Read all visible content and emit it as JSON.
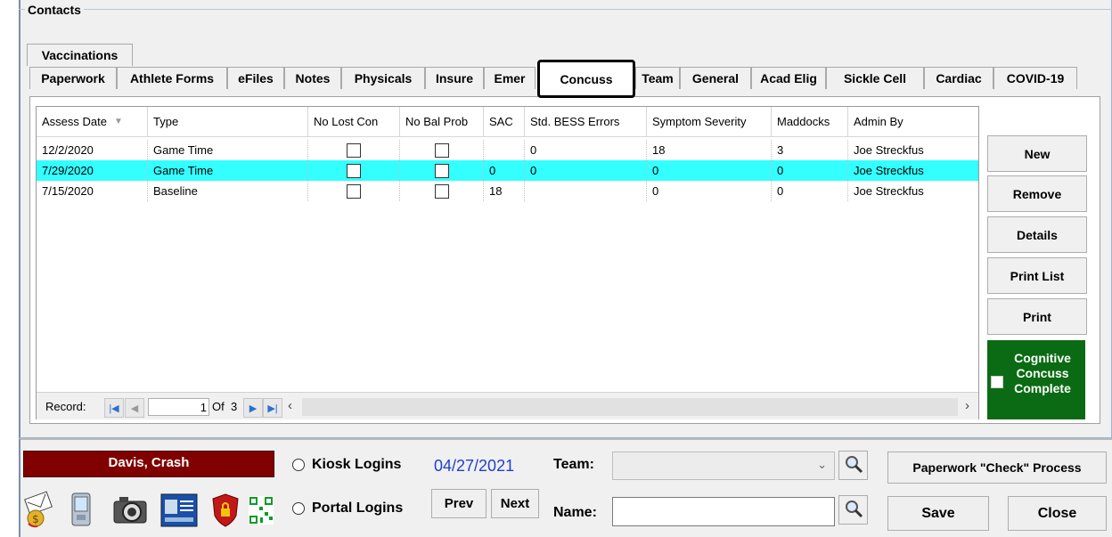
{
  "group_title": "Contacts",
  "tabs_row1": [
    {
      "label": "Vaccinations"
    }
  ],
  "tabs_row2": [
    {
      "label": "Paperwork"
    },
    {
      "label": "Athlete Forms"
    },
    {
      "label": "eFiles"
    },
    {
      "label": "Notes"
    },
    {
      "label": "Physicals"
    },
    {
      "label": "Insure"
    },
    {
      "label": "Emer"
    },
    {
      "label": "Concuss"
    },
    {
      "label": "Team"
    },
    {
      "label": "General"
    },
    {
      "label": "Acad Elig"
    },
    {
      "label": "Sickle Cell"
    },
    {
      "label": "Cardiac"
    },
    {
      "label": "COVID-19"
    }
  ],
  "active_tab": "Concuss",
  "grid": {
    "columns": [
      "Assess Date",
      "Type",
      "No Lost Con",
      "No Bal Prob",
      "SAC",
      "Std. BESS Errors",
      "Symptom Severity",
      "Maddocks",
      "Admin By"
    ],
    "rows": [
      {
        "date": "12/2/2020",
        "type": "Game Time",
        "no_lost_con": false,
        "no_bal_prob": false,
        "sac": "",
        "bess": "0",
        "severity": "18",
        "maddocks": "3",
        "admin": "Joe Streckfus",
        "selected": false
      },
      {
        "date": "7/29/2020",
        "type": "Game Time",
        "no_lost_con": false,
        "no_bal_prob": false,
        "sac": "0",
        "bess": "0",
        "severity": "0",
        "maddocks": "0",
        "admin": "Joe Streckfus",
        "selected": true
      },
      {
        "date": "7/15/2020",
        "type": "Baseline",
        "no_lost_con": false,
        "no_bal_prob": false,
        "sac": "18",
        "bess": "",
        "severity": "0",
        "maddocks": "0",
        "admin": "Joe Streckfus",
        "selected": false
      }
    ],
    "record_label": "Record:",
    "record_current": "1",
    "record_of": "Of  3"
  },
  "side_buttons": {
    "new": "New",
    "remove": "Remove",
    "details": "Details",
    "print_list": "Print List",
    "print": "Print"
  },
  "cognitive": {
    "line1": "Cognitive",
    "line2": "Concuss",
    "line3": "Complete",
    "checked": false,
    "color": "#0b6b14"
  },
  "bottom": {
    "athlete_name": "Davis, Crash",
    "name_bg": "#800000",
    "kiosk_label": "Kiosk Logins",
    "portal_label": "Portal Logins",
    "date": "04/27/2021",
    "date_color": "#1f3fd0",
    "prev": "Prev",
    "next": "Next",
    "team_label": "Team:",
    "team_value": "",
    "name_label": "Name:",
    "name_value": "",
    "paperwork_button": "Paperwork \"Check\" Process",
    "save": "Save",
    "close": "Close"
  },
  "icons": [
    "envelope-icon",
    "handheld-device-icon",
    "camera-icon",
    "id-card-icon",
    "shield-lock-icon",
    "qr-code-icon",
    "magnifier-icon"
  ]
}
